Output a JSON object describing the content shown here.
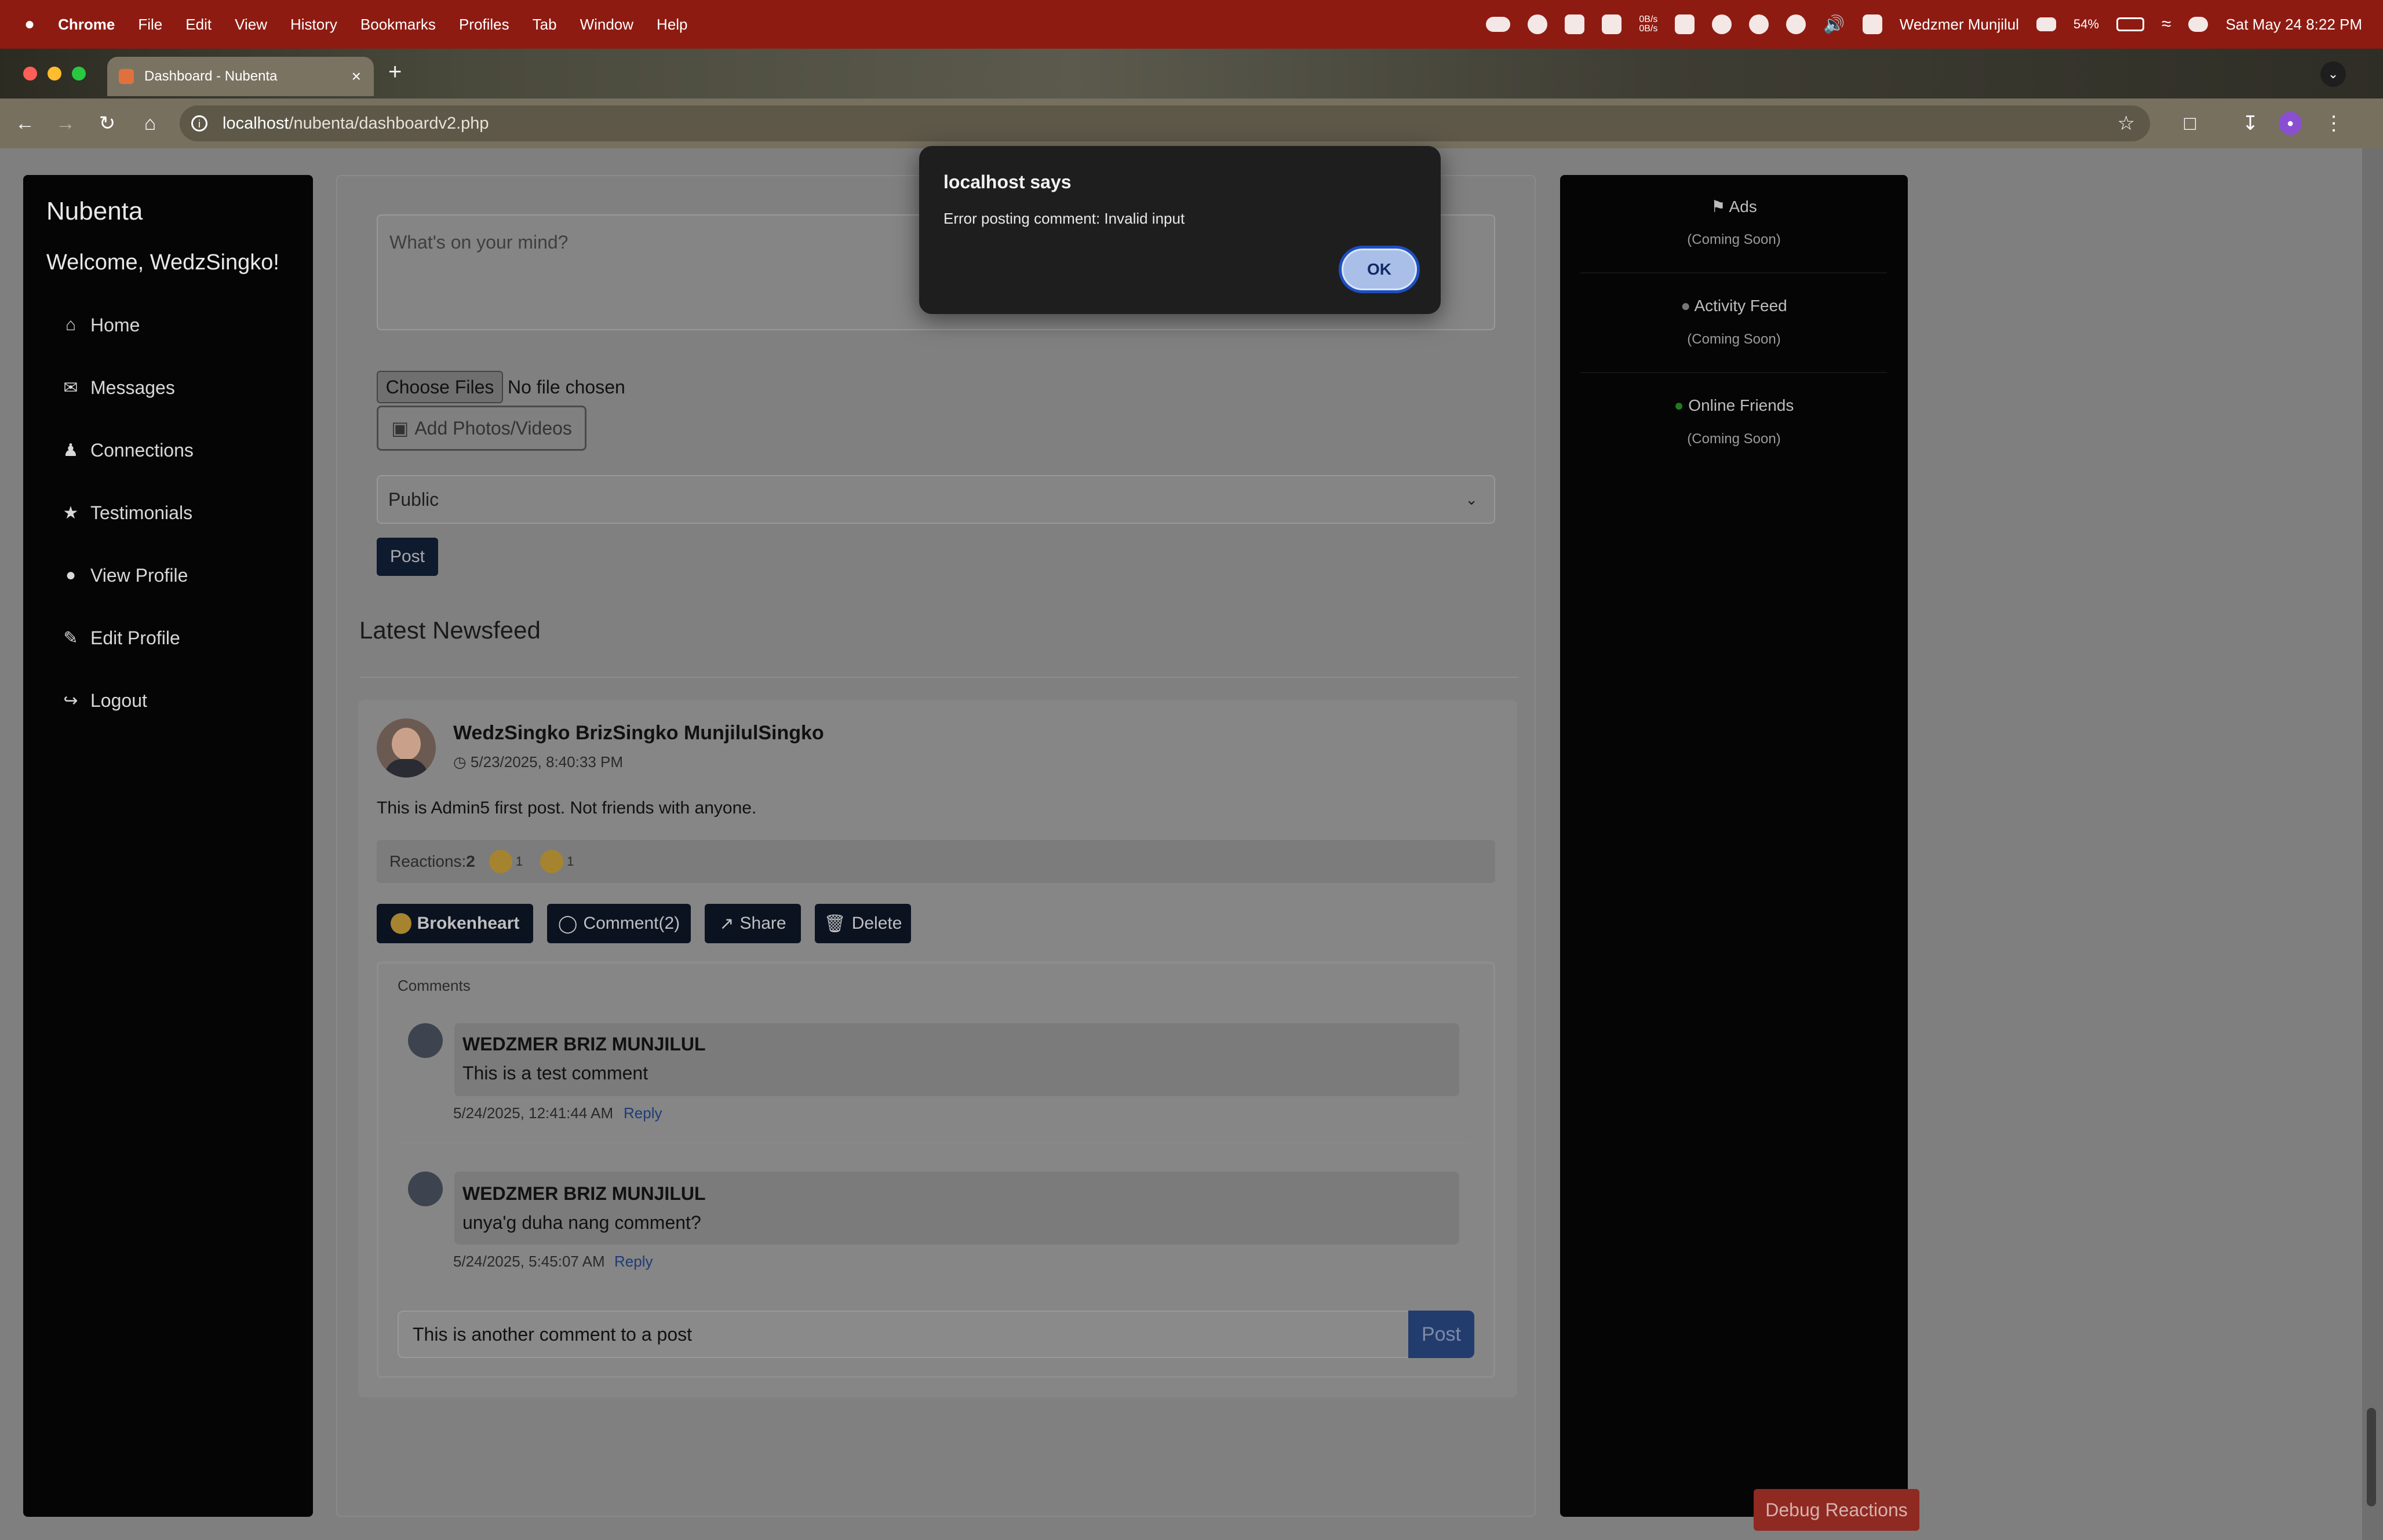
{
  "menubar": {
    "apple": "",
    "app": "Chrome",
    "items": [
      "File",
      "Edit",
      "View",
      "History",
      "Bookmarks",
      "Profiles",
      "Tab",
      "Window",
      "Help"
    ],
    "net_up": "0B/s",
    "net_down": "0B/s",
    "user": "Wedzmer Munjilul",
    "battery": "54%",
    "datetime": "Sat May 24  8:22 PM"
  },
  "browser": {
    "tab_title": "Dashboard - Nubenta",
    "url_host": "localhost",
    "url_path": "/nubenta/dashboardv2.php"
  },
  "sidebar": {
    "brand": "Nubenta",
    "welcome": "Welcome, WedzSingko!",
    "items": [
      {
        "label": "Home",
        "icon": "home-icon"
      },
      {
        "label": "Messages",
        "icon": "envelope-icon"
      },
      {
        "label": "Connections",
        "icon": "users-icon"
      },
      {
        "label": "Testimonials",
        "icon": "star-icon"
      },
      {
        "label": "View Profile",
        "icon": "user-icon"
      },
      {
        "label": "Edit Profile",
        "icon": "user-edit-icon"
      },
      {
        "label": "Logout",
        "icon": "logout-icon"
      }
    ]
  },
  "composer": {
    "placeholder": "What's on your mind?",
    "choose_files": "Choose Files",
    "no_file": "No file chosen",
    "add_media": "Add Photos/Videos",
    "privacy": "Public",
    "post": "Post"
  },
  "feed": {
    "title": "Latest Newsfeed",
    "post": {
      "author": "WedzSingko BrizSingko MunjilulSingko",
      "time": "5/23/2025, 8:40:33 PM",
      "body": "This is Admin5 first post. Not friends with anyone.",
      "reactions_label": "Reactions:",
      "reactions_total": "2",
      "reaction_counts": [
        "1",
        "1"
      ],
      "actions": {
        "react": "Brokenheart",
        "comment": "Comment(2)",
        "share": "Share",
        "delete": "Delete"
      },
      "comments_label": "Comments",
      "comments": [
        {
          "author": "WEDZMER BRIZ MUNJILUL",
          "text": "This is a test comment",
          "time": "5/24/2025, 12:41:44 AM",
          "reply": "Reply"
        },
        {
          "author": "WEDZMER BRIZ MUNJILUL",
          "text": "unya'g duha nang comment?",
          "time": "5/24/2025, 5:45:07 AM",
          "reply": "Reply"
        }
      ],
      "comment_input": "This is another comment to a post",
      "comment_post": "Post"
    }
  },
  "rightcol": {
    "widgets": [
      {
        "title": "Ads",
        "sub": "(Coming Soon)"
      },
      {
        "title": "Activity Feed",
        "sub": "(Coming Soon)"
      },
      {
        "title": "Online Friends",
        "sub": "(Coming Soon)"
      }
    ]
  },
  "debug_button": "Debug Reactions",
  "dialog": {
    "title": "localhost says",
    "message": "Error posting comment: Invalid input",
    "ok": "OK"
  }
}
